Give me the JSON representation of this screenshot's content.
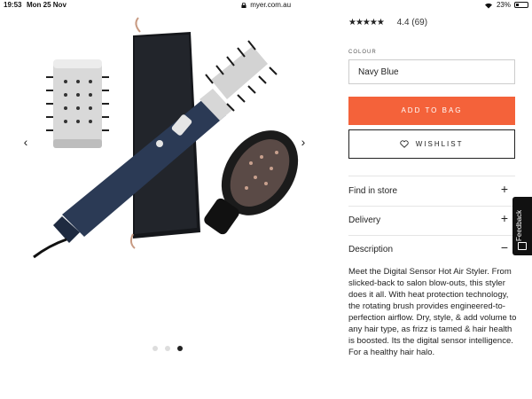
{
  "statusbar": {
    "time": "19:53",
    "date": "Mon 25 Nov",
    "url": "myer.com.au",
    "battery": "23%",
    "battery_level": 0.23
  },
  "gallery": {
    "prev_arrow": "‹",
    "next_arrow": "›",
    "dots_total": 3,
    "active_dot": 3
  },
  "product": {
    "rating": "4.4 (69)",
    "stars": "★★★★★",
    "colour_label": "COLOUR",
    "colour_value": "Navy Blue",
    "add_to_bag": "ADD TO BAG",
    "wishlist": "WISHLIST"
  },
  "accordion": [
    {
      "label": "Find in store",
      "sign": "+"
    },
    {
      "label": "Delivery",
      "sign": "+"
    },
    {
      "label": "Description",
      "sign": "−"
    }
  ],
  "description": "Meet the Digital Sensor Hot Air Styler. From slicked-back to salon blow-outs, this styler does it all. With heat protection technology, the rotating brush provides engineered-to-perfection airflow. Dry, style, & add volume to any hair type, as frizz is tamed &  hair health is boosted. Its the digital sensor intelligence. For a  healthy hair halo.",
  "feedback": "Feedback",
  "colors": {
    "accent": "#f4623a",
    "navy": "#2b3a55"
  }
}
